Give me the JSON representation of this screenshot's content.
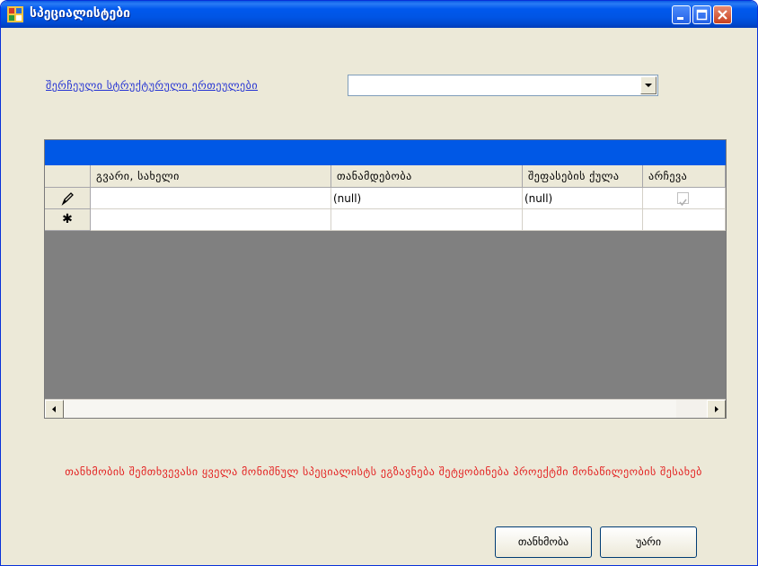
{
  "window": {
    "title": "სპეციალისტები",
    "accent": "#0058e6"
  },
  "filter": {
    "link_label": "შერჩეული სტრუქტურული ერთეულები",
    "combo_value": ""
  },
  "grid": {
    "columns": [
      "გვარი, სახელი",
      "თანამდებობა",
      "შეფასების ქულა",
      "არჩევა"
    ],
    "rows": [
      {
        "indicator": "pencil-icon",
        "name": "",
        "position": "(null)",
        "score": "(null)",
        "selected": true
      }
    ],
    "new_row_indicator": "asterisk"
  },
  "message": "თანხმობის შემთხვევასი ყველა მონიშნულ სპეციალისტს ეგზავნება შეტყობინება პროექტში მონაწილეობის შესახებ",
  "buttons": {
    "ok": "თანხმობა",
    "cancel": "უარი"
  }
}
